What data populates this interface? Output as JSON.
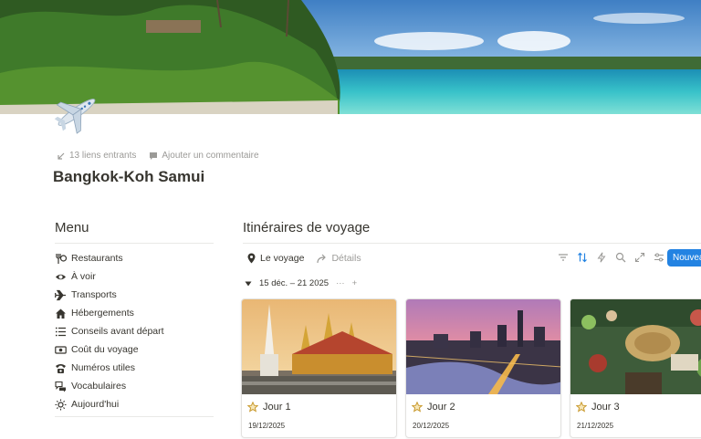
{
  "page": {
    "title": "Bangkok-Koh Samui",
    "backlinks": "13 liens entrants",
    "add_comment": "Ajouter un commentaire",
    "icon": "airplane-emoji"
  },
  "menu": {
    "title": "Menu",
    "items": [
      {
        "label": "Restaurants",
        "icon": "fork-knife-icon"
      },
      {
        "label": "À voir",
        "icon": "eye-icon"
      },
      {
        "label": "Transports",
        "icon": "airplane-icon"
      },
      {
        "label": "Hébergements",
        "icon": "house-icon"
      },
      {
        "label": "Conseils avant départ",
        "icon": "list-icon"
      },
      {
        "label": "Coût du voyage",
        "icon": "banknote-icon"
      },
      {
        "label": "Numéros utiles",
        "icon": "phone-icon"
      },
      {
        "label": "Vocabulaires",
        "icon": "chat-icon"
      },
      {
        "label": "Aujourd'hui",
        "icon": "sun-icon"
      }
    ]
  },
  "database": {
    "title": "Itinéraires de voyage",
    "tabs": [
      {
        "label": "Le voyage",
        "icon": "map-pin-icon",
        "active": true
      },
      {
        "label": "Détails",
        "icon": "share-arrow-icon",
        "active": false
      }
    ],
    "tools": [
      "filter-icon",
      "sort-icon",
      "lightning-icon",
      "search-icon",
      "expand-icon",
      "settings-icon"
    ],
    "new_button": "Nouveau",
    "group": {
      "label": "15 déc. – 21 2025",
      "more": "···",
      "add": "+"
    },
    "cards": [
      {
        "name": "Jour 1",
        "date": "19/12/2025",
        "image": "temple-photo"
      },
      {
        "name": "Jour 2",
        "date": "20/12/2025",
        "image": "city-skyline-photo"
      },
      {
        "name": "Jour 3",
        "date": "21/12/2025",
        "image": "floating-market-photo"
      }
    ]
  },
  "colors": {
    "accent": "#2383e2",
    "text": "#37352f",
    "muted": "#9b9a97",
    "star": "#c99a2e"
  }
}
